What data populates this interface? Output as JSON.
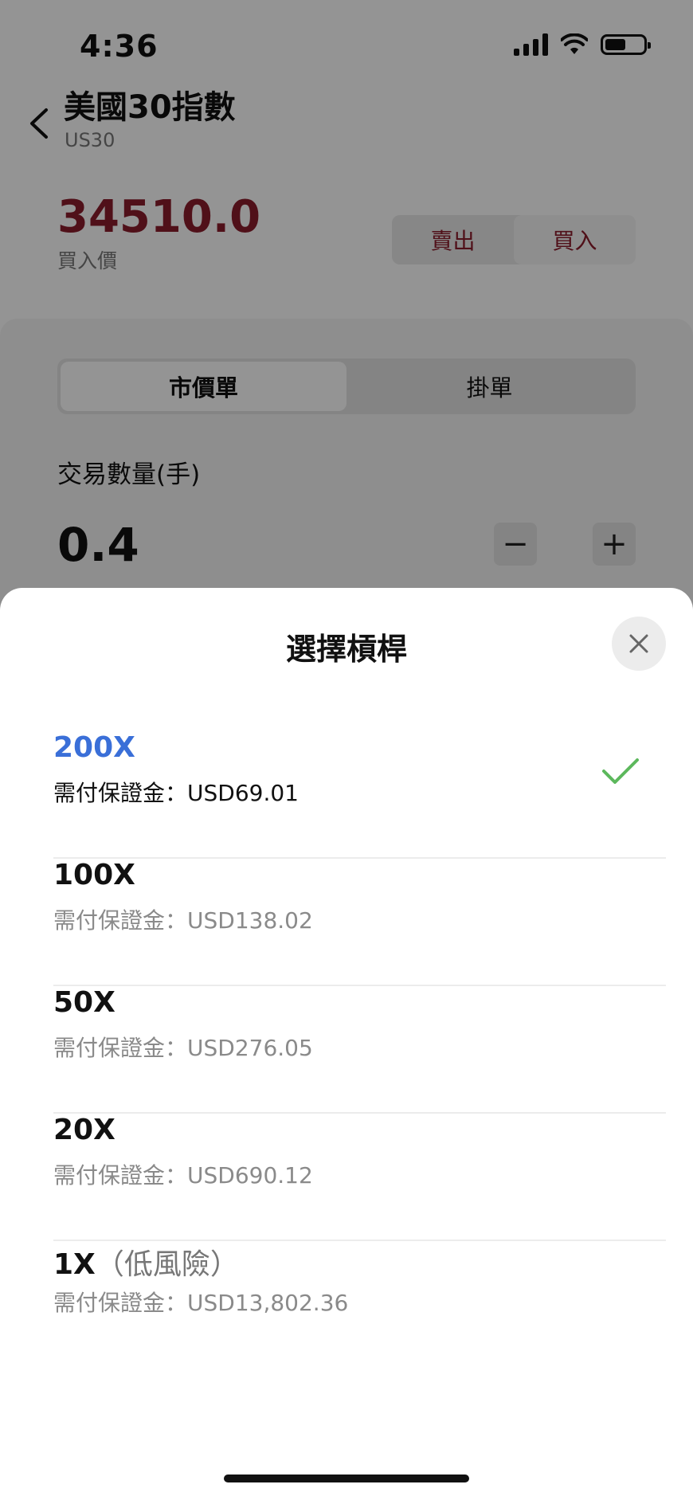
{
  "status": {
    "time": "4:36"
  },
  "header": {
    "title": "美國30指數",
    "symbol": "US30"
  },
  "quote": {
    "price": "34510.0",
    "price_label": "買入價",
    "sell_label": "賣出",
    "buy_label": "買入"
  },
  "order_type": {
    "tabs": [
      "市價單",
      "掛單"
    ]
  },
  "quantity": {
    "label": "交易數量(手)",
    "value": "0.4",
    "minus": "−",
    "plus": "+"
  },
  "sheet": {
    "title": "選擇槓桿",
    "options": [
      {
        "label": "200X",
        "note": "",
        "margin": "需付保證金：USD69.01",
        "selected": true
      },
      {
        "label": "100X",
        "note": "",
        "margin": "需付保證金：USD138.02"
      },
      {
        "label": "50X",
        "note": "",
        "margin": "需付保證金：USD276.05"
      },
      {
        "label": "20X",
        "note": "",
        "margin": "需付保證金：USD690.12"
      },
      {
        "label": "1X",
        "note": "（低風險）",
        "margin": "需付保證金：USD13,802.36"
      }
    ]
  },
  "colors": {
    "selected": "#3a6fd8",
    "check": "#5cb85c",
    "price": "#8b1d2b"
  }
}
